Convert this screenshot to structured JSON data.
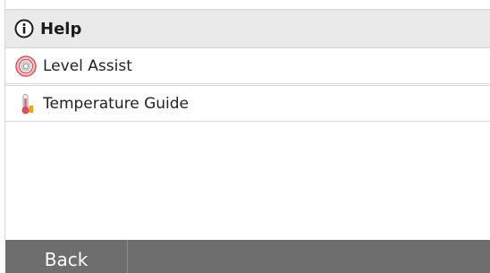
{
  "header": {
    "title": "Help",
    "icon": "info-circle-icon"
  },
  "list": {
    "items": [
      {
        "label": "Level Assist",
        "icon": "target-rings-icon",
        "icon_color": "#e0505a"
      },
      {
        "label": "Temperature Guide",
        "icon": "thermometer-icon",
        "icon_color": "#e8a41a"
      }
    ]
  },
  "footer": {
    "back_label": "Back"
  },
  "colors": {
    "header_bg": "#eaeaea",
    "footer_bg": "#6e6e6e",
    "divider": "#d8d8d8"
  }
}
